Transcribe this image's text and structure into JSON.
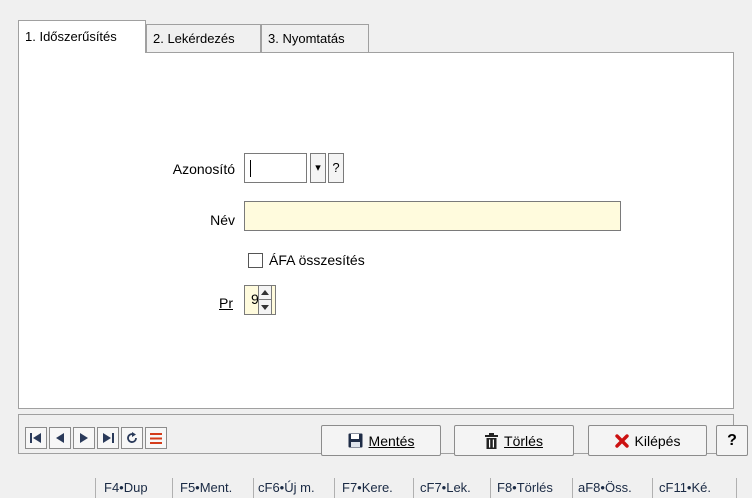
{
  "tabs": [
    "1. Időszerűsítés",
    "2. Lekérdezés",
    "3. Nyomtatás"
  ],
  "form": {
    "azonosito_label": "Azonosító",
    "azonosito_value": "",
    "dropdown_glyph": "▾",
    "help_glyph": "?",
    "nev_label": "Név",
    "nev_value": "",
    "afa_label": "ÁFA összesítés",
    "afa_checked": false,
    "pr_label": "Pr",
    "pr_value": "9"
  },
  "toolbar": {
    "save_label": "Mentés",
    "delete_label": "Törlés",
    "exit_label": "Kilépés",
    "help_label": "?"
  },
  "fkeys": [
    "F4•Dup",
    "F5•Ment.",
    "cF6•Új m.",
    "F7•Kere.",
    "cF7•Lek.",
    "F8•Törlés",
    "aF8•Öss.",
    "cF11•Ké."
  ],
  "colors": {
    "input_highlight": "#fffbdd",
    "exit_icon": "#cc1111",
    "nav_icon": "#2a3a5a"
  }
}
